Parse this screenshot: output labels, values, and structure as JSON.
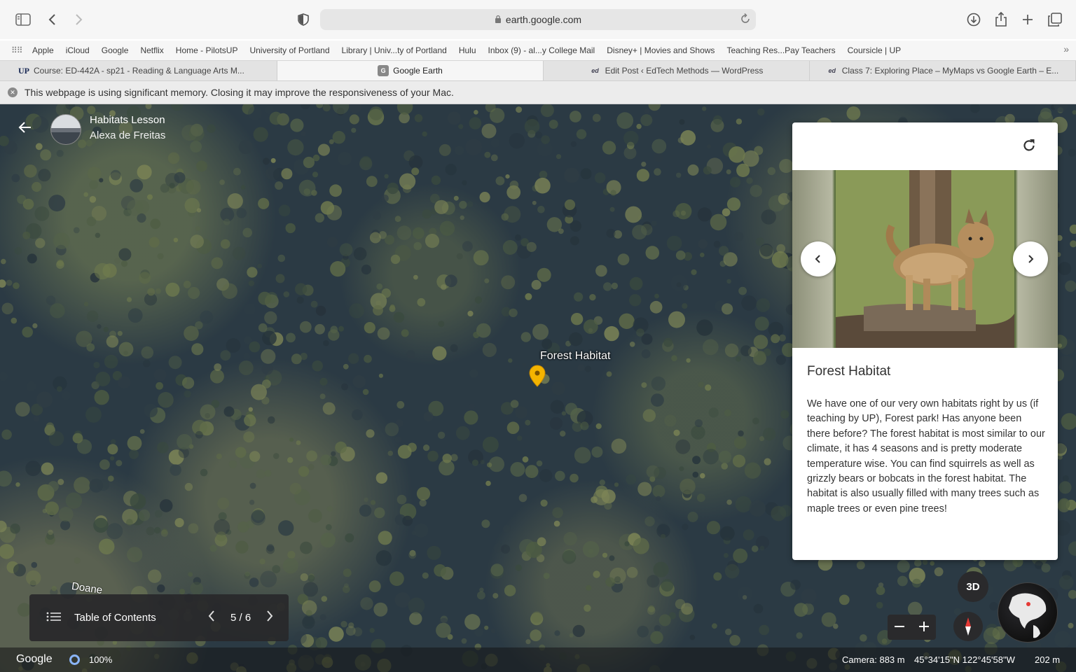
{
  "browser": {
    "url": "earth.google.com",
    "favorites": [
      "Apple",
      "iCloud",
      "Google",
      "Netflix",
      "Home - PilotsUP",
      "University of Portland",
      "Library | Univ...ty of Portland",
      "Hulu",
      "Inbox (9) - al...y College Mail",
      "Disney+ | Movies and Shows",
      "Teaching Res...Pay Teachers",
      "Coursicle | UP"
    ],
    "tabs": [
      {
        "label": "Course: ED-442A - sp21 - Reading & Language Arts M...",
        "favicon": "UP"
      },
      {
        "label": "Google Earth",
        "favicon": "G"
      },
      {
        "label": "Edit Post ‹ EdTech Methods — WordPress",
        "favicon": "ed"
      },
      {
        "label": "Class 7: Exploring Place – MyMaps vs Google Earth – E...",
        "favicon": "ed"
      }
    ],
    "warning": "This webpage is using significant memory. Closing it may improve the responsiveness of your Mac."
  },
  "tour": {
    "title": "Habitats Lesson",
    "author": "Alexa de Freitas"
  },
  "map": {
    "pin_label": "Forest Habitat",
    "road_label": "Doane"
  },
  "card": {
    "title": "Forest Habitat",
    "body": "We have one of our very own habitats right by us (if teaching by UP), Forest park! Has anyone been there before? The forest habitat is most similar to our climate, it has 4 seasons and is pretty moderate temperature wise. You can find squirrels as well as grizzly bears or bobcats in the forest habitat. The habitat is also usually filled with many trees such as maple trees or even pine trees!"
  },
  "toc": {
    "label": "Table of Contents",
    "page": "5 / 6"
  },
  "controls": {
    "btn_3d": "3D"
  },
  "status": {
    "brand": "Google",
    "percent": "100%",
    "camera": "Camera: 883 m",
    "coords": "45°34'15\"N 122°45'58\"W",
    "scale": "202 m"
  },
  "colors": {
    "pin": "#f4b400",
    "ring": "#8ab4f8"
  }
}
